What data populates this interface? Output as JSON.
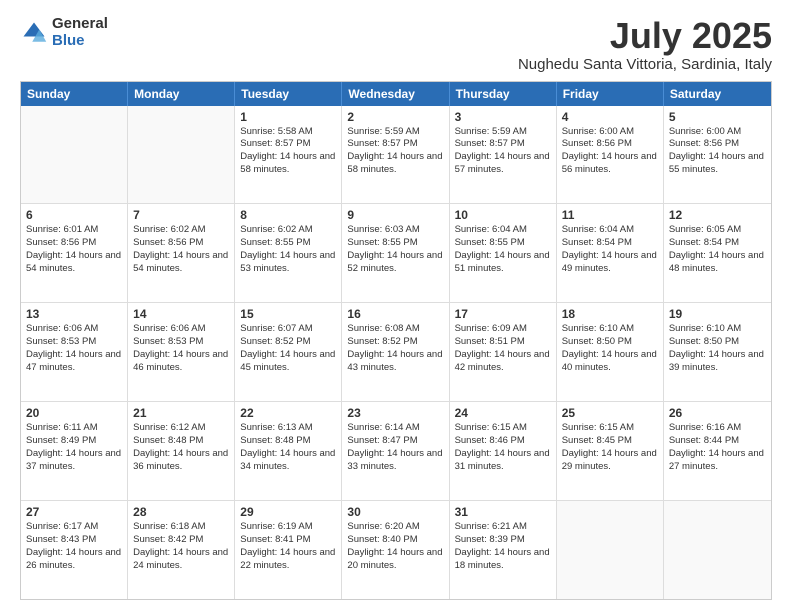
{
  "logo": {
    "general": "General",
    "blue": "Blue"
  },
  "header": {
    "title": "July 2025",
    "subtitle": "Nughedu Santa Vittoria, Sardinia, Italy"
  },
  "weekdays": [
    "Sunday",
    "Monday",
    "Tuesday",
    "Wednesday",
    "Thursday",
    "Friday",
    "Saturday"
  ],
  "weeks": [
    [
      {
        "day": "",
        "info": ""
      },
      {
        "day": "",
        "info": ""
      },
      {
        "day": "1",
        "info": "Sunrise: 5:58 AM\nSunset: 8:57 PM\nDaylight: 14 hours and 58 minutes."
      },
      {
        "day": "2",
        "info": "Sunrise: 5:59 AM\nSunset: 8:57 PM\nDaylight: 14 hours and 58 minutes."
      },
      {
        "day": "3",
        "info": "Sunrise: 5:59 AM\nSunset: 8:57 PM\nDaylight: 14 hours and 57 minutes."
      },
      {
        "day": "4",
        "info": "Sunrise: 6:00 AM\nSunset: 8:56 PM\nDaylight: 14 hours and 56 minutes."
      },
      {
        "day": "5",
        "info": "Sunrise: 6:00 AM\nSunset: 8:56 PM\nDaylight: 14 hours and 55 minutes."
      }
    ],
    [
      {
        "day": "6",
        "info": "Sunrise: 6:01 AM\nSunset: 8:56 PM\nDaylight: 14 hours and 54 minutes."
      },
      {
        "day": "7",
        "info": "Sunrise: 6:02 AM\nSunset: 8:56 PM\nDaylight: 14 hours and 54 minutes."
      },
      {
        "day": "8",
        "info": "Sunrise: 6:02 AM\nSunset: 8:55 PM\nDaylight: 14 hours and 53 minutes."
      },
      {
        "day": "9",
        "info": "Sunrise: 6:03 AM\nSunset: 8:55 PM\nDaylight: 14 hours and 52 minutes."
      },
      {
        "day": "10",
        "info": "Sunrise: 6:04 AM\nSunset: 8:55 PM\nDaylight: 14 hours and 51 minutes."
      },
      {
        "day": "11",
        "info": "Sunrise: 6:04 AM\nSunset: 8:54 PM\nDaylight: 14 hours and 49 minutes."
      },
      {
        "day": "12",
        "info": "Sunrise: 6:05 AM\nSunset: 8:54 PM\nDaylight: 14 hours and 48 minutes."
      }
    ],
    [
      {
        "day": "13",
        "info": "Sunrise: 6:06 AM\nSunset: 8:53 PM\nDaylight: 14 hours and 47 minutes."
      },
      {
        "day": "14",
        "info": "Sunrise: 6:06 AM\nSunset: 8:53 PM\nDaylight: 14 hours and 46 minutes."
      },
      {
        "day": "15",
        "info": "Sunrise: 6:07 AM\nSunset: 8:52 PM\nDaylight: 14 hours and 45 minutes."
      },
      {
        "day": "16",
        "info": "Sunrise: 6:08 AM\nSunset: 8:52 PM\nDaylight: 14 hours and 43 minutes."
      },
      {
        "day": "17",
        "info": "Sunrise: 6:09 AM\nSunset: 8:51 PM\nDaylight: 14 hours and 42 minutes."
      },
      {
        "day": "18",
        "info": "Sunrise: 6:10 AM\nSunset: 8:50 PM\nDaylight: 14 hours and 40 minutes."
      },
      {
        "day": "19",
        "info": "Sunrise: 6:10 AM\nSunset: 8:50 PM\nDaylight: 14 hours and 39 minutes."
      }
    ],
    [
      {
        "day": "20",
        "info": "Sunrise: 6:11 AM\nSunset: 8:49 PM\nDaylight: 14 hours and 37 minutes."
      },
      {
        "day": "21",
        "info": "Sunrise: 6:12 AM\nSunset: 8:48 PM\nDaylight: 14 hours and 36 minutes."
      },
      {
        "day": "22",
        "info": "Sunrise: 6:13 AM\nSunset: 8:48 PM\nDaylight: 14 hours and 34 minutes."
      },
      {
        "day": "23",
        "info": "Sunrise: 6:14 AM\nSunset: 8:47 PM\nDaylight: 14 hours and 33 minutes."
      },
      {
        "day": "24",
        "info": "Sunrise: 6:15 AM\nSunset: 8:46 PM\nDaylight: 14 hours and 31 minutes."
      },
      {
        "day": "25",
        "info": "Sunrise: 6:15 AM\nSunset: 8:45 PM\nDaylight: 14 hours and 29 minutes."
      },
      {
        "day": "26",
        "info": "Sunrise: 6:16 AM\nSunset: 8:44 PM\nDaylight: 14 hours and 27 minutes."
      }
    ],
    [
      {
        "day": "27",
        "info": "Sunrise: 6:17 AM\nSunset: 8:43 PM\nDaylight: 14 hours and 26 minutes."
      },
      {
        "day": "28",
        "info": "Sunrise: 6:18 AM\nSunset: 8:42 PM\nDaylight: 14 hours and 24 minutes."
      },
      {
        "day": "29",
        "info": "Sunrise: 6:19 AM\nSunset: 8:41 PM\nDaylight: 14 hours and 22 minutes."
      },
      {
        "day": "30",
        "info": "Sunrise: 6:20 AM\nSunset: 8:40 PM\nDaylight: 14 hours and 20 minutes."
      },
      {
        "day": "31",
        "info": "Sunrise: 6:21 AM\nSunset: 8:39 PM\nDaylight: 14 hours and 18 minutes."
      },
      {
        "day": "",
        "info": ""
      },
      {
        "day": "",
        "info": ""
      }
    ]
  ]
}
